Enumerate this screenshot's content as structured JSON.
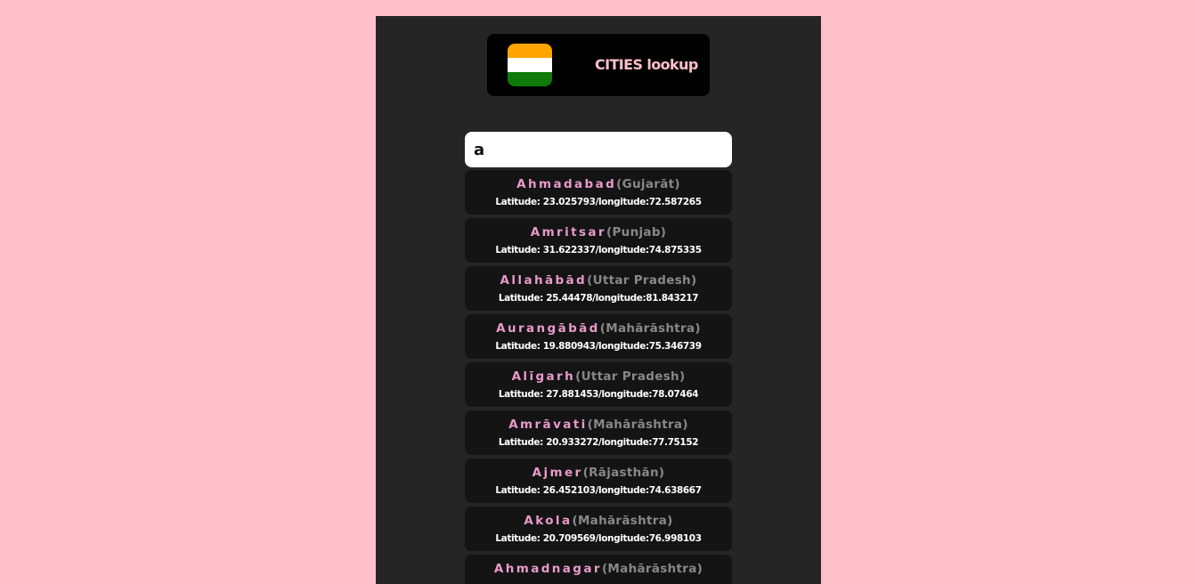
{
  "header": {
    "title": "CITIES lookup",
    "flag_colors": [
      "#ffa400",
      "#ffffff",
      "#0d7a0a"
    ]
  },
  "search": {
    "value": "a"
  },
  "results": [
    {
      "city": "Ahmadabad",
      "state": "(Gujarāt)",
      "coords": "Latitude: 23.025793/longitude:72.587265"
    },
    {
      "city": "Amritsar",
      "state": "(Punjab)",
      "coords": "Latitude: 31.622337/longitude:74.875335"
    },
    {
      "city": "Allahābād",
      "state": "(Uttar Pradesh)",
      "coords": "Latitude: 25.44478/longitude:81.843217"
    },
    {
      "city": "Aurangābād",
      "state": "(Mahārāshtra)",
      "coords": "Latitude: 19.880943/longitude:75.346739"
    },
    {
      "city": "Alīgarh",
      "state": "(Uttar Pradesh)",
      "coords": "Latitude: 27.881453/longitude:78.07464"
    },
    {
      "city": "Amrāvati",
      "state": "(Mahārāshtra)",
      "coords": "Latitude: 20.933272/longitude:77.75152"
    },
    {
      "city": "Ajmer",
      "state": "(Rājasthān)",
      "coords": "Latitude: 26.452103/longitude:74.638667"
    },
    {
      "city": "Akola",
      "state": "(Mahārāshtra)",
      "coords": "Latitude: 20.709569/longitude:76.998103"
    },
    {
      "city": "Ahmadnagar",
      "state": "(Mahārāshtra)",
      "coords": ""
    }
  ],
  "colors": {
    "page_background": "#ffc0cb",
    "panel_background": "#252525",
    "card_background": "#141414",
    "city_name": "#e89aca",
    "state_name": "#888888",
    "title": "#ffc0cb"
  }
}
